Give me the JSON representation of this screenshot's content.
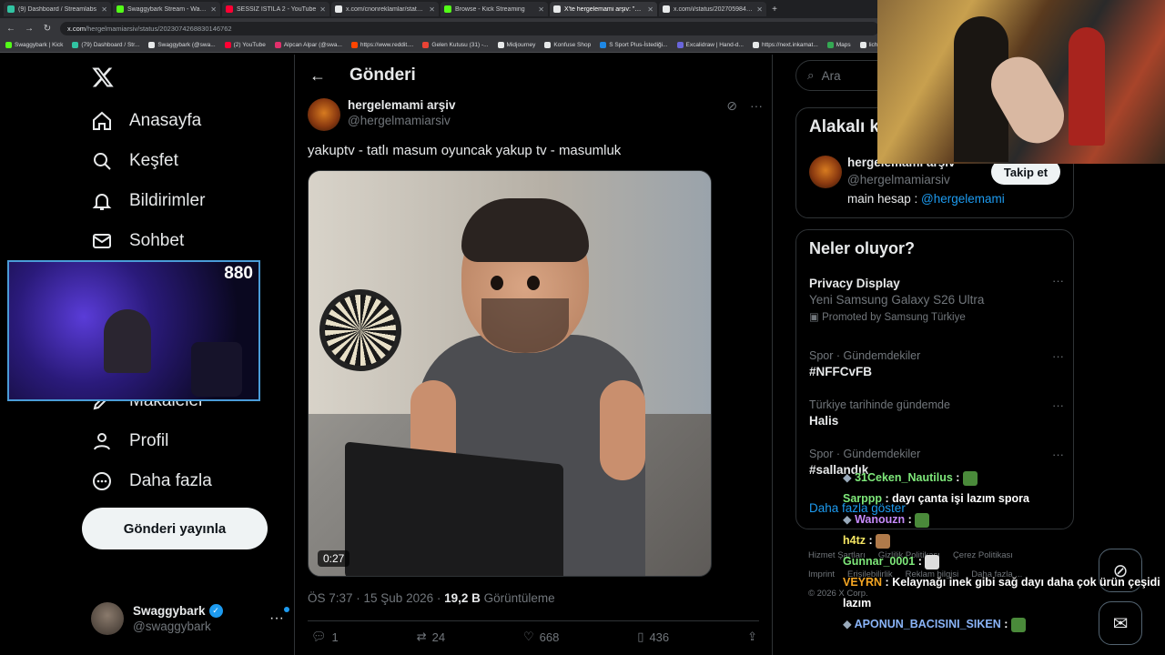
{
  "browser": {
    "tabs": [
      {
        "label": "(9) Dashboard / Streamlabs",
        "color": "#31c3a2",
        "active": false
      },
      {
        "label": "Swaggybark Stream - Watch Live",
        "color": "#53fc18",
        "active": false
      },
      {
        "label": "SESSİZ İSTİLA 2 - YouTube",
        "color": "#ff0033",
        "active": false
      },
      {
        "label": "x.com/cnonreklamlar/status/20",
        "color": "#e7e9ea",
        "active": false
      },
      {
        "label": "Browse - Kick Streaming",
        "color": "#53fc18",
        "active": false
      },
      {
        "label": "X'te hergelemami arşiv: \"yakup",
        "color": "#e7e9ea",
        "active": true
      },
      {
        "label": "x.com/i/status/20270598448",
        "color": "#e7e9ea",
        "active": false
      }
    ],
    "url_host": "x.com",
    "url_path": "/hergelmamiarsiv/status/2023074268830146762",
    "bookmarks": [
      {
        "label": "Swaggybark | Kick",
        "color": "#53fc18"
      },
      {
        "label": "(79) Dashboard / Str...",
        "color": "#31c3a2"
      },
      {
        "label": "Swaggybark (@swa...",
        "color": "#e7e9ea"
      },
      {
        "label": "(2) YouTube",
        "color": "#ff0033"
      },
      {
        "label": "Alpcan Alpar (@swa...",
        "color": "#e1306c"
      },
      {
        "label": "https://www.reddit....",
        "color": "#ff4500"
      },
      {
        "label": "Gelen Kutusu (31) -...",
        "color": "#ea4335"
      },
      {
        "label": "Midjourney",
        "color": "#e7e9ea"
      },
      {
        "label": "Konfuse Shop",
        "color": "#e7e9ea"
      },
      {
        "label": "S Sport Plus-İstediği...",
        "color": "#1e88e5"
      },
      {
        "label": "Excalidraw | Hand-d...",
        "color": "#6965db"
      },
      {
        "label": "https://next.inkamat...",
        "color": "#e7e9ea"
      },
      {
        "label": "Maps",
        "color": "#34a853"
      },
      {
        "label": "lichess.org",
        "color": "#e7e9ea"
      }
    ]
  },
  "nav": {
    "items": [
      {
        "label": "Anasayfa",
        "icon": "home-icon"
      },
      {
        "label": "Keşfet",
        "icon": "search-icon"
      },
      {
        "label": "Bildirimler",
        "icon": "bell-icon"
      },
      {
        "label": "Sohbet",
        "icon": "mail-icon"
      },
      {
        "label": "Makaleler",
        "icon": "article-icon"
      },
      {
        "label": "Profil",
        "icon": "person-icon"
      },
      {
        "label": "Daha fazla",
        "icon": "more-circle-icon"
      }
    ],
    "post_button": "Gönderi yayınla",
    "account_name": "Swaggybark",
    "account_handle": "@swaggybark"
  },
  "post": {
    "header_title": "Gönderi",
    "author_name": "hergelemami arşiv",
    "author_handle": "@hergelmamiarsiv",
    "text": "yakuptv - tatlı masum oyuncak yakup tv - masumluk",
    "video_duration": "0:27",
    "timestamp": "ÖS 7:37 · 15 Şub 2026 · ",
    "views_count": "19,2 B",
    "views_label": " Görüntüleme",
    "replies": "1",
    "reposts": "24",
    "likes": "668",
    "bookmarks": "436"
  },
  "sidebar": {
    "search_placeholder": "Ara",
    "related_title": "Alakalı k",
    "related_name": "hergelemami arşiv",
    "related_handle": "@hergelmamiarsiv",
    "related_bio": "main hesap : ",
    "related_bio_link": "@hergelemami",
    "follow_button": "Takip et",
    "trends_title": "Neler oluyor?",
    "trends": [
      {
        "context": "",
        "name": "Privacy Display",
        "sub": "Yeni Samsung Galaxy S26 Ultra",
        "promo": "Promoted by Samsung Türkiye"
      },
      {
        "context": "Spor · Gündemdekiler",
        "name": "#NFFCvFB",
        "sub": "",
        "promo": ""
      },
      {
        "context": "Türkiye tarihinde gündemde",
        "name": "Halis",
        "sub": "",
        "promo": ""
      },
      {
        "context": "Spor · Gündemdekiler",
        "name": "#sallandık",
        "sub": "",
        "promo": ""
      }
    ],
    "show_more": "Daha fazla göster",
    "footer": [
      "Hizmet Şartları",
      "Gizlilik Politikası",
      "Çerez Politikası",
      "Imprint",
      "Erişilebilirlik",
      "Reklam bilgisi",
      "Daha fazla ...",
      "© 2026 X Corp."
    ]
  },
  "stream": {
    "viewer_count": "880",
    "chat": [
      {
        "user": "31Ceken_Nautilus",
        "color": "#7ee87a",
        "msg": "",
        "badge": true,
        "emote": "#4a8a3a"
      },
      {
        "user": "Sarppp",
        "color": "#7ee87a",
        "msg": "dayı çanta işi lazım spora",
        "badge": false,
        "emote": ""
      },
      {
        "user": "Wanouzn",
        "color": "#c58af9",
        "msg": "",
        "badge": true,
        "emote": "#4a8a3a"
      },
      {
        "user": "h4tz",
        "color": "#f5e663",
        "msg": "",
        "badge": false,
        "emote": "#b07a4a"
      },
      {
        "user": "Gunnar_0001",
        "color": "#7ee87a",
        "msg": "",
        "badge": false,
        "emote": "#dddddd"
      },
      {
        "user": "VEYRN",
        "color": "#f5a623",
        "msg": "Kelaynağı inek gibi sağ dayı daha çok ürün çeşidi lazım",
        "badge": false,
        "emote": ""
      },
      {
        "user": "APONUN_BACISINI_SIKEN",
        "color": "#8ab4f8",
        "msg": "",
        "badge": true,
        "emote": "#4a8a3a"
      }
    ]
  }
}
